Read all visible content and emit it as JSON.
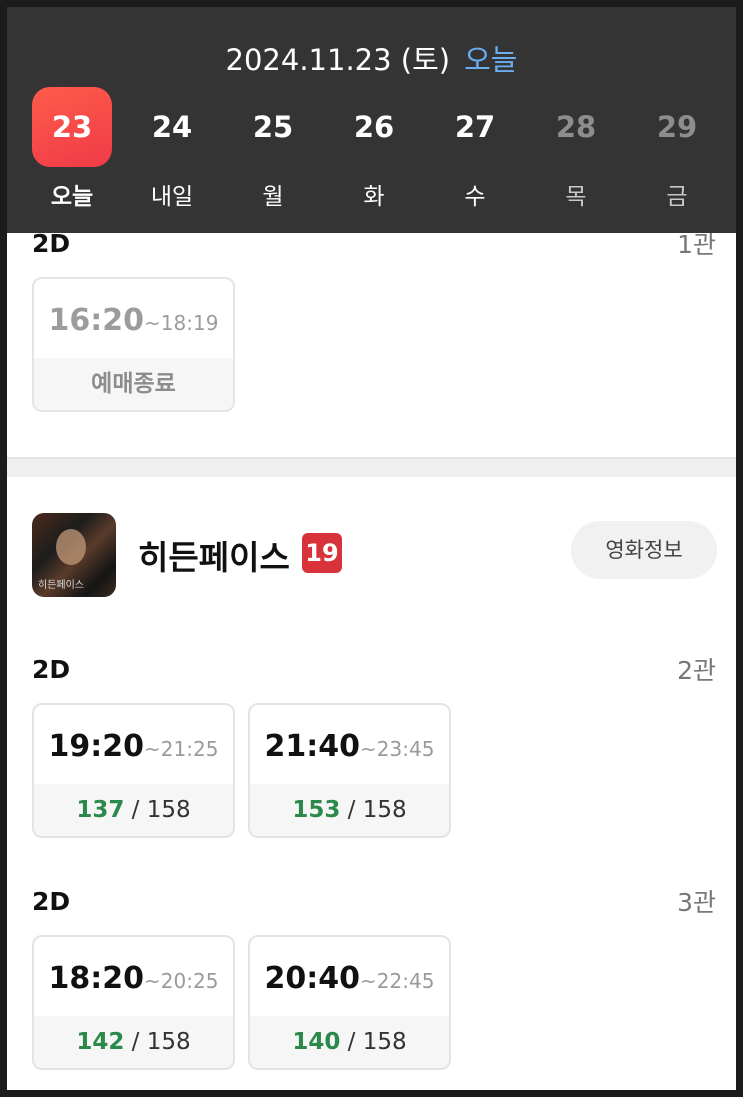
{
  "header": {
    "date": "2024.11.23 (토)",
    "today_link": "오늘",
    "days": [
      {
        "num": "23",
        "label": "오늘"
      },
      {
        "num": "24",
        "label": "내일"
      },
      {
        "num": "25",
        "label": "월"
      },
      {
        "num": "26",
        "label": "화"
      },
      {
        "num": "27",
        "label": "수"
      },
      {
        "num": "28",
        "label": "목"
      },
      {
        "num": "29",
        "label": "금"
      }
    ]
  },
  "prev_movie": {
    "format": "2D",
    "hall": "1관",
    "showtimes": [
      {
        "start": "16:20",
        "end": "~18:19",
        "status": "예매종료"
      }
    ]
  },
  "movie": {
    "title": "히든페이스",
    "rating": "19",
    "poster_caption": "히든페이스",
    "info_button": "영화정보",
    "screenings": [
      {
        "format": "2D",
        "hall": "2관",
        "showtimes": [
          {
            "start": "19:20",
            "end": "~21:25",
            "available": "137",
            "sep": " / ",
            "total": "158"
          },
          {
            "start": "21:40",
            "end": "~23:45",
            "available": "153",
            "sep": " / ",
            "total": "158"
          }
        ]
      },
      {
        "format": "2D",
        "hall": "3관",
        "showtimes": [
          {
            "start": "18:20",
            "end": "~20:25",
            "available": "142",
            "sep": " / ",
            "total": "158"
          },
          {
            "start": "20:40",
            "end": "~22:45",
            "available": "140",
            "sep": " / ",
            "total": "158"
          }
        ]
      }
    ]
  },
  "colors": {
    "active_day": "#ef3b48",
    "today_link": "#6aaef0",
    "available_seats": "#2b8a4b",
    "rating_badge": "#d8323a"
  }
}
